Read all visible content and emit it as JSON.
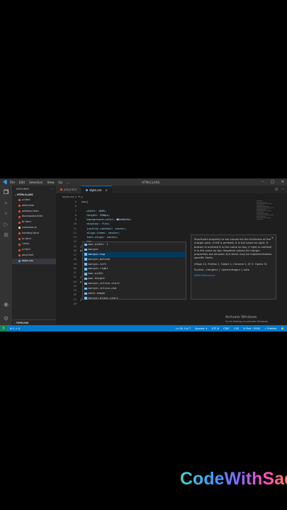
{
  "window": {
    "menu": [
      "File",
      "Edit",
      "Selection",
      "View",
      "Go",
      "..."
    ],
    "title": "HTMLCLASS"
  },
  "explorer": {
    "title": "EXPLORER",
    "folder": "HTMLCLASS",
    "files": [
      {
        "name": "a.html",
        "color": "#e44d26"
      },
      {
        "name": "abbr.html",
        "color": "#e44d26"
      },
      {
        "name": "address.html",
        "color": "#e44d26"
      },
      {
        "name": "blockquote.html",
        "color": "#e44d26"
      },
      {
        "name": "br.html",
        "color": "#e44d26"
      },
      {
        "name": "customer.js",
        "color": "#f1e05a"
      },
      {
        "name": "heading.html",
        "color": "#e44d26"
      },
      {
        "name": "hr.html",
        "color": "#e44d26"
      },
      {
        "name": "i.html",
        "color": "#e44d26"
      },
      {
        "name": "p.html",
        "color": "#e44d26"
      },
      {
        "name": "play.html",
        "color": "#e44d26"
      },
      {
        "name": "style.css",
        "color": "#42a5f5"
      }
    ],
    "timeline": "TIMELINE"
  },
  "tabs": [
    {
      "label": "play.html",
      "active": false
    },
    {
      "label": "style.css",
      "active": true
    }
  ],
  "breadcrumb": "style.css > ✦ p",
  "code": {
    "line_numbers": [
      "5",
      "6",
      "7",
      "8",
      "9",
      "10",
      "11",
      "12",
      "13",
      "14",
      "15",
      "16",
      "17",
      "18",
      "19",
      "20",
      "21",
      "22",
      "23",
      "24",
      "25",
      "26",
      "27",
      "28"
    ],
    "lines": [
      ".box{",
      "",
      "    width: 100%;",
      "    height: 500px;",
      "    background-color: ■#ab8a5a;",
      "    display: flex;",
      "    justify-content: center;",
      "    align-items: center;",
      "    text-align: center;",
      "    box",
      "}",
      "button",
      "    pa",
      "    bo",
      "    co",
      "    bo",
      "    bo",
      "}",
      "p{",
      "    fo",
      "    ma",
      "",
      "}",
      ""
    ]
  },
  "suggestions": [
    {
      "label": "max-width: 1",
      "highlight": "",
      "selected": false
    },
    {
      "label": "margin",
      "highlight": "",
      "selected": false
    },
    {
      "label": "margin-top",
      "highlight": "ma",
      "selected": true
    },
    {
      "label": "margin-bottom",
      "highlight": "",
      "selected": false
    },
    {
      "label": "margin-left",
      "highlight": "",
      "selected": false
    },
    {
      "label": "margin-right",
      "highlight": "",
      "selected": false
    },
    {
      "label": "max-width",
      "highlight": "",
      "selected": false
    },
    {
      "label": "max-height",
      "highlight": "",
      "selected": false
    },
    {
      "label": "margin-inline-start",
      "highlight": "",
      "selected": false
    },
    {
      "label": "margin-inline-end",
      "highlight": "",
      "selected": false
    },
    {
      "label": "mask-image",
      "highlight": "",
      "selected": false
    },
    {
      "label": "margin-block-start",
      "highlight": "",
      "selected": false
    }
  ],
  "docs": {
    "description": "Shorthand property to set values for the thickness of the margin area. If left is omitted, it is the same as right. If bottom is omitted it is the same as top, if right is omitted it is the same as top. Negative values for margin properties are allowed, but there may be implementation-specific limits.",
    "browsers": "(Edge 12, Firefox 1, Safari 1, Chrome 1, IE 3, Opera 3)",
    "syntax": "Syntax: <length> | <percentage> | auto",
    "reference": "MDN Reference"
  },
  "activate": {
    "title": "Activate Windows",
    "sub": "Go to Settings to activate Windows."
  },
  "status": {
    "errors": "⊗ 0 ⚠ 0",
    "position": "Ln 26, Col 7",
    "spaces": "Spaces: 4",
    "encoding": "UTF-8",
    "eol": "CRLF",
    "language": "CSS",
    "port": "⊘ Port : 5500",
    "prettier": "✓ Prettier"
  },
  "watermark": "CodeWithSad",
  "colors": {
    "accent": "#007acc",
    "editor_bg": "#1e1e1e"
  }
}
